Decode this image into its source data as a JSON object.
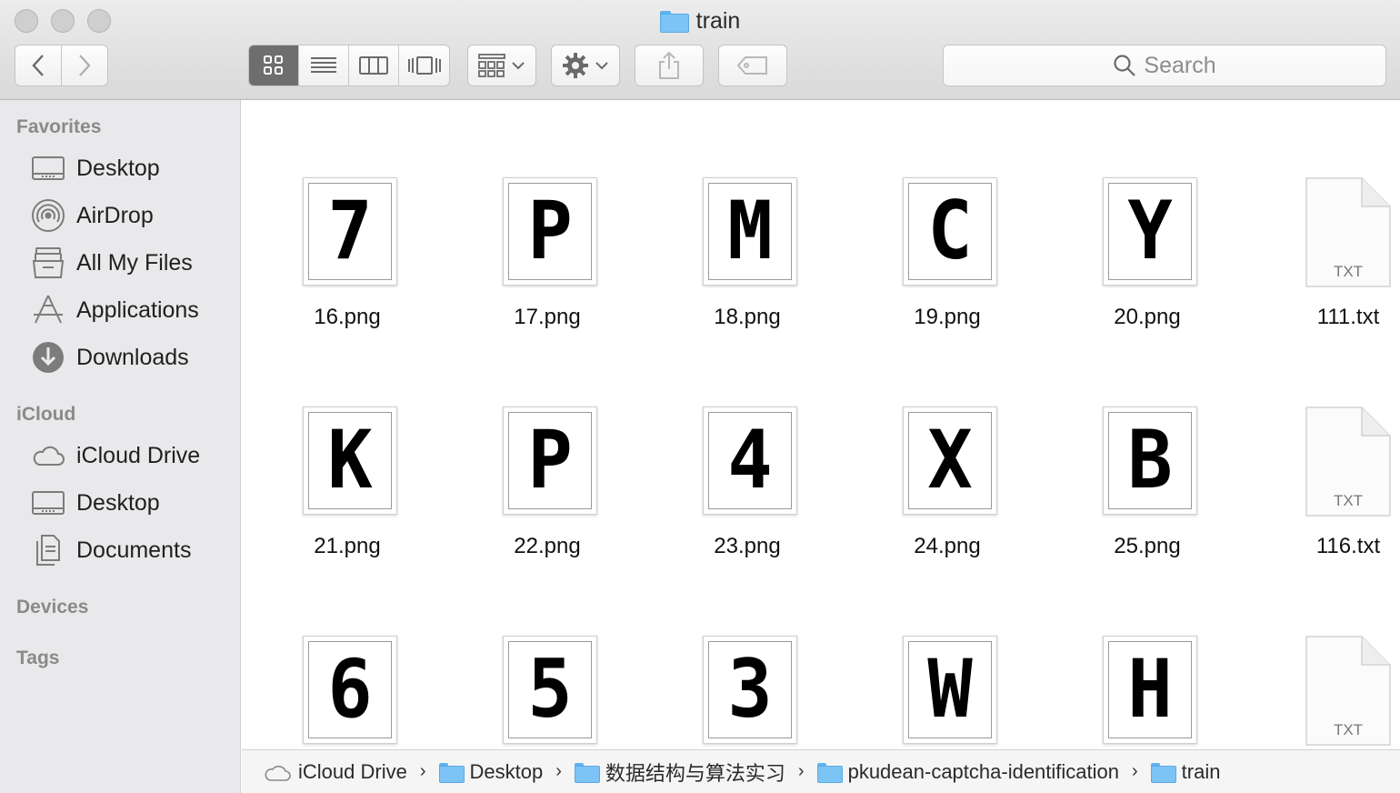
{
  "window": {
    "title": "train"
  },
  "toolbar": {
    "search_placeholder": "Search"
  },
  "sidebar": {
    "favorites_header": "Favorites",
    "favorites": [
      {
        "label": "Desktop",
        "icon": "desktop-icon"
      },
      {
        "label": "AirDrop",
        "icon": "airdrop-icon"
      },
      {
        "label": "All My Files",
        "icon": "all-my-files-icon"
      },
      {
        "label": "Applications",
        "icon": "applications-icon"
      },
      {
        "label": "Downloads",
        "icon": "downloads-icon"
      }
    ],
    "icloud_header": "iCloud",
    "icloud": [
      {
        "label": "iCloud Drive",
        "icon": "cloud-icon"
      },
      {
        "label": "Desktop",
        "icon": "desktop-icon"
      },
      {
        "label": "Documents",
        "icon": "documents-icon"
      }
    ],
    "devices_header": "Devices",
    "tags_header": "Tags"
  },
  "files": {
    "row1": [
      {
        "name": "16.png",
        "glyph": "7"
      },
      {
        "name": "17.png",
        "glyph": "P"
      },
      {
        "name": "18.png",
        "glyph": "M"
      },
      {
        "name": "19.png",
        "glyph": "C"
      },
      {
        "name": "20.png",
        "glyph": "Y"
      }
    ],
    "row1_txt": {
      "name": "111.txt",
      "type_label": "TXT"
    },
    "row2": [
      {
        "name": "21.png",
        "glyph": "K"
      },
      {
        "name": "22.png",
        "glyph": "P"
      },
      {
        "name": "23.png",
        "glyph": "4"
      },
      {
        "name": "24.png",
        "glyph": "X"
      },
      {
        "name": "25.png",
        "glyph": "B"
      }
    ],
    "row2_txt": {
      "name": "116.txt",
      "type_label": "TXT"
    },
    "row3": [
      {
        "glyph": "6"
      },
      {
        "glyph": "5"
      },
      {
        "glyph": "3"
      },
      {
        "glyph": "W"
      },
      {
        "glyph": "H"
      }
    ],
    "row3_txt": {
      "type_label": "TXT"
    }
  },
  "pathbar": {
    "crumbs": [
      "iCloud Drive",
      "Desktop",
      "数据结构与算法实习",
      "pkudean-captcha-identification",
      "train"
    ]
  }
}
